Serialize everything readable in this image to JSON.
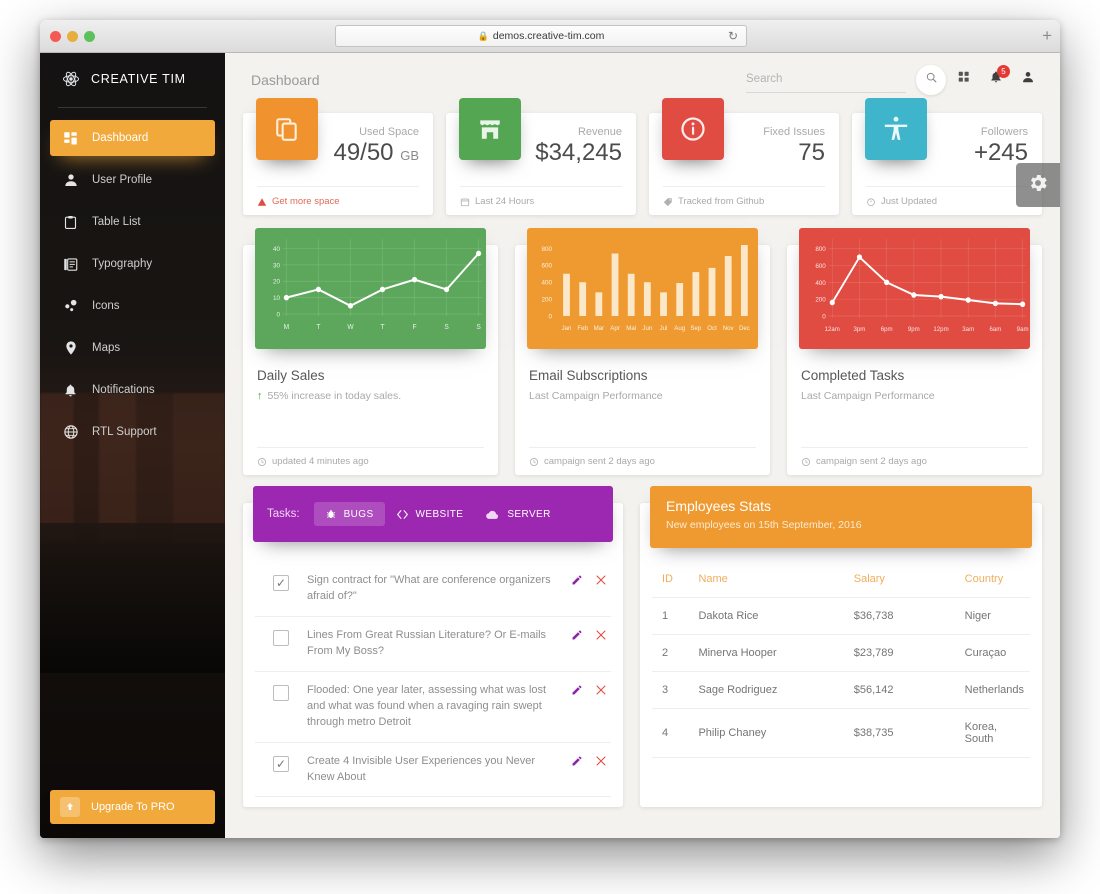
{
  "browser": {
    "url": "demos.creative-tim.com",
    "lock_icon": "lock-icon",
    "reload_icon": "reload-icon",
    "new_tab_label": "+"
  },
  "sidebar": {
    "brand": "CREATIVE TIM",
    "brand_icon": "atom-icon",
    "items": [
      {
        "label": "Dashboard",
        "icon": "dashboard-icon",
        "active": true
      },
      {
        "label": "User Profile",
        "icon": "person-icon",
        "active": false
      },
      {
        "label": "Table List",
        "icon": "clipboard-icon",
        "active": false
      },
      {
        "label": "Typography",
        "icon": "typography-icon",
        "active": false
      },
      {
        "label": "Icons",
        "icon": "bubble-chart-icon",
        "active": false
      },
      {
        "label": "Maps",
        "icon": "location-pin-icon",
        "active": false
      },
      {
        "label": "Notifications",
        "icon": "bell-icon",
        "active": false
      },
      {
        "label": "RTL Support",
        "icon": "globe-icon",
        "active": false
      }
    ],
    "upgrade": {
      "label": "Upgrade To PRO",
      "icon": "upgrade-icon"
    }
  },
  "topnav": {
    "title": "Dashboard",
    "search_placeholder": "Search",
    "search_value": "",
    "search_icon": "search-icon",
    "apps_icon": "grid-apps-icon",
    "bell_icon": "bell-icon",
    "notification_count": "5",
    "person_icon": "person-icon"
  },
  "settings_fab": {
    "icon": "gear-icon"
  },
  "stats": [
    {
      "icon": "copy-files-icon",
      "color": "#f0932f",
      "label": "Used Space",
      "value": "49/50",
      "unit": "GB",
      "footer": "Get more space",
      "footer_icon": "warning-icon",
      "footer_warn": true
    },
    {
      "icon": "store-icon",
      "color": "#54a653",
      "label": "Revenue",
      "value": "$34,245",
      "unit": "",
      "footer": "Last 24 Hours",
      "footer_icon": "calendar-icon",
      "footer_warn": false
    },
    {
      "icon": "info-circle-icon",
      "color": "#e04b42",
      "label": "Fixed Issues",
      "value": "75",
      "unit": "",
      "footer": "Tracked from Github",
      "footer_icon": "tag-icon",
      "footer_warn": false
    },
    {
      "icon": "accessibility-icon",
      "color": "#3fb5cc",
      "label": "Followers",
      "value": "+245",
      "unit": "",
      "footer": "Just Updated",
      "footer_icon": "refresh-clock-icon",
      "footer_warn": false
    }
  ],
  "chart_cards": [
    {
      "title": "Daily Sales",
      "subtitle": "55% increase in today sales.",
      "subtitle_icon": "arrow-up-icon",
      "footer": "updated 4 minutes ago",
      "footer_icon": "clock-icon",
      "color": "#5ca75b"
    },
    {
      "title": "Email Subscriptions",
      "subtitle": "Last Campaign Performance",
      "subtitle_icon": "",
      "footer": "campaign sent 2 days ago",
      "footer_icon": "clock-icon",
      "color": "#ef9a30"
    },
    {
      "title": "Completed Tasks",
      "subtitle": "Last Campaign Performance",
      "subtitle_icon": "",
      "footer": "campaign sent 2 days ago",
      "footer_icon": "clock-icon",
      "color": "#e04b42"
    }
  ],
  "chart_data": [
    {
      "type": "line",
      "title": "Daily Sales",
      "categories": [
        "M",
        "T",
        "W",
        "T",
        "F",
        "S",
        "S"
      ],
      "values": [
        10,
        15,
        5,
        15,
        21,
        15,
        37
      ],
      "yticks": [
        0,
        10,
        20,
        30,
        40
      ],
      "ylim": [
        0,
        44
      ],
      "xlabel": "",
      "ylabel": "",
      "grid": true,
      "legend": "none",
      "series_color": "#ffffff",
      "panel_color": "#5ca75b"
    },
    {
      "type": "bar",
      "title": "Email Subscriptions",
      "categories": [
        "Jan",
        "Feb",
        "Mar",
        "Apr",
        "Mai",
        "Jun",
        "Jul",
        "Aug",
        "Sep",
        "Oct",
        "Nov",
        "Dec"
      ],
      "values": [
        500,
        400,
        280,
        740,
        500,
        400,
        280,
        390,
        520,
        570,
        710,
        840
      ],
      "yticks": [
        0,
        200,
        400,
        600,
        800
      ],
      "ylim": [
        0,
        900
      ],
      "xlabel": "",
      "ylabel": "",
      "grid": false,
      "legend": "none",
      "series_color": "#fbe8c8",
      "panel_color": "#ef9a30"
    },
    {
      "type": "line",
      "title": "Completed Tasks",
      "categories": [
        "12am",
        "3pm",
        "6pm",
        "9pm",
        "12pm",
        "3am",
        "6am",
        "9am"
      ],
      "values": [
        160,
        700,
        400,
        250,
        230,
        190,
        150,
        140
      ],
      "yticks": [
        0,
        200,
        400,
        600,
        800
      ],
      "ylim": [
        0,
        880
      ],
      "xlabel": "",
      "ylabel": "",
      "grid": true,
      "legend": "none",
      "series_color": "#ffffff",
      "panel_color": "#e04b42"
    }
  ],
  "tasks_panel": {
    "label": "Tasks:",
    "tabs": [
      {
        "label": "BUGS",
        "icon": "bug-icon",
        "active": true
      },
      {
        "label": "WEBSITE",
        "icon": "code-icon",
        "active": false
      },
      {
        "label": "SERVER",
        "icon": "cloud-icon",
        "active": false
      }
    ],
    "edit_icon": "pencil-icon",
    "delete_icon": "close-x-icon",
    "rows": [
      {
        "checked": true,
        "text": "Sign contract for \"What are conference organizers afraid of?\""
      },
      {
        "checked": false,
        "text": "Lines From Great Russian Literature? Or E-mails From My Boss?"
      },
      {
        "checked": false,
        "text": "Flooded: One year later, assessing what was lost and what was found when a ravaging rain swept through metro Detroit"
      },
      {
        "checked": true,
        "text": "Create 4 Invisible User Experiences you Never Knew About"
      }
    ]
  },
  "employees_panel": {
    "title": "Employees Stats",
    "subtitle": "New employees on 15th September, 2016",
    "columns": [
      "ID",
      "Name",
      "Salary",
      "Country"
    ],
    "rows": [
      {
        "id": "1",
        "name": "Dakota Rice",
        "salary": "$36,738",
        "country": "Niger"
      },
      {
        "id": "2",
        "name": "Minerva Hooper",
        "salary": "$23,789",
        "country": "Curaçao"
      },
      {
        "id": "3",
        "name": "Sage Rodriguez",
        "salary": "$56,142",
        "country": "Netherlands"
      },
      {
        "id": "4",
        "name": "Philip Chaney",
        "salary": "$38,735",
        "country": "Korea, South"
      }
    ]
  }
}
